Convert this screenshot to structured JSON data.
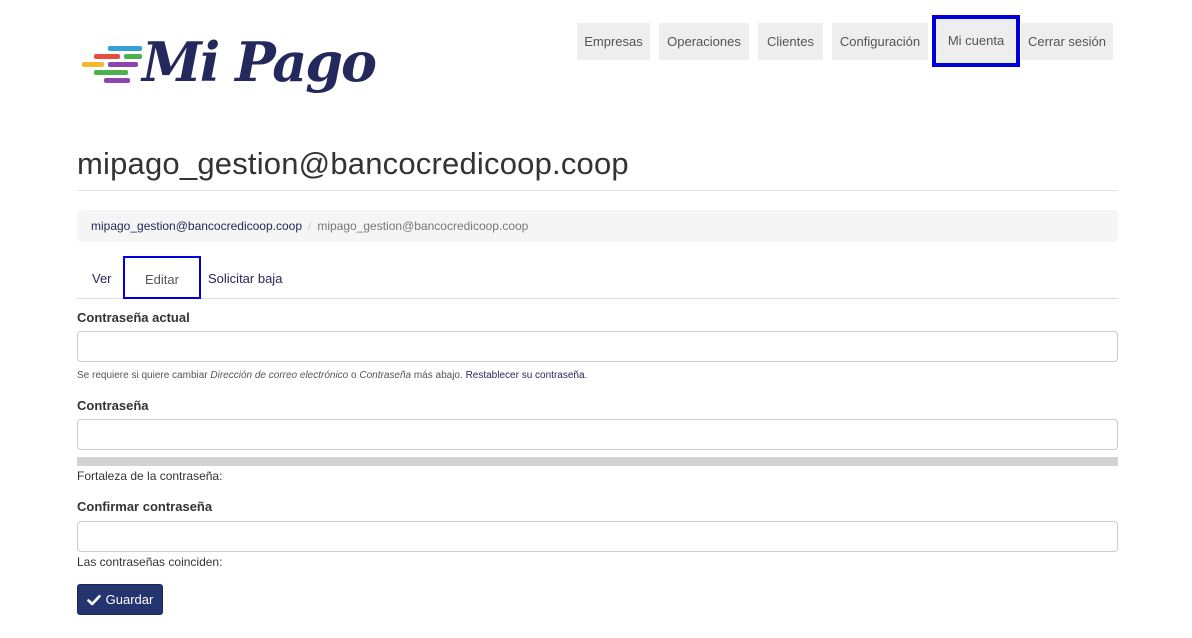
{
  "brand": {
    "name": "Mi Pago",
    "colors": [
      "#e94c3d",
      "#f5b82e",
      "#35a0d8",
      "#8e44ad",
      "#4caf50"
    ]
  },
  "nav": {
    "items": [
      {
        "label": "Empresas"
      },
      {
        "label": "Operaciones"
      },
      {
        "label": "Clientes"
      },
      {
        "label": "Configuración"
      },
      {
        "label": "Mi cuenta"
      },
      {
        "label": "Cerrar sesión"
      }
    ]
  },
  "page": {
    "title": "mipago_gestion@bancocredicoop.coop"
  },
  "breadcrumb": {
    "link": "mipago_gestion@bancocredicoop.coop",
    "separator": "/",
    "current": "mipago_gestion@bancocredicoop.coop"
  },
  "tabs": [
    {
      "label": "Ver"
    },
    {
      "label": "Editar"
    },
    {
      "label": "Solicitar baja"
    }
  ],
  "form": {
    "current_password": {
      "label": "Contraseña actual",
      "help_prefix": "Se requiere si quiere cambiar ",
      "help_em1": "Dirección de correo electrónico",
      "help_mid": " o ",
      "help_em2": "Contraseña",
      "help_suffix": " más abajo. ",
      "help_link": "Restablecer su contraseña",
      "help_end": "."
    },
    "password": {
      "label": "Contraseña",
      "strength_label": "Fortaleza de la contraseña:"
    },
    "confirm_password": {
      "label": "Confirmar contraseña",
      "match_label": "Las contraseñas coinciden:"
    },
    "save_label": "Guardar"
  },
  "icons": {
    "save": "check-icon"
  }
}
